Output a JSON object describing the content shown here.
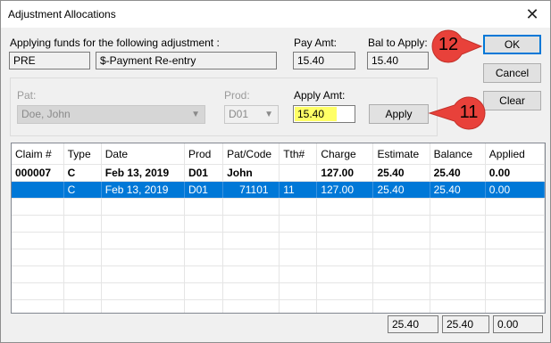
{
  "window": {
    "title": "Adjustment Allocations",
    "close_glyph": "✕"
  },
  "header": {
    "applying_label": "Applying funds for the following adjustment :",
    "code_value": "PRE",
    "desc_value": "$-Payment Re-entry",
    "pay_amt_label": "Pay Amt:",
    "pay_amt_value": "15.40",
    "bal_label": "Bal to Apply:",
    "bal_value": "15.40"
  },
  "form": {
    "pat_label": "Pat:",
    "pat_value": "Doe, John",
    "prod_label": "Prod:",
    "prod_value": "D01",
    "apply_amt_label": "Apply Amt:",
    "apply_amt_value": "15.40",
    "apply_button": "Apply"
  },
  "buttons": {
    "ok": "OK",
    "cancel": "Cancel",
    "clear": "Clear"
  },
  "markers": {
    "a": "12",
    "b": "11",
    "color": "#e8413a"
  },
  "table": {
    "columns": [
      "Claim #",
      "Type",
      "Date",
      "Prod",
      "Pat/Code",
      "Tth#",
      "Charge",
      "Estimate",
      "Balance",
      "Applied"
    ],
    "rows": [
      [
        "000007",
        "C",
        "Feb 13, 2019",
        "D01",
        "John",
        "",
        "127.00",
        "25.40",
        "25.40",
        "0.00"
      ],
      [
        "",
        "C",
        "Feb 13, 2019",
        "D01",
        "71101",
        "11",
        "127.00",
        "25.40",
        "25.40",
        "0.00"
      ]
    ]
  },
  "totals": {
    "estimate": "25.40",
    "balance": "25.40",
    "applied": "0.00"
  },
  "colors": {
    "selection": "#0078d7",
    "highlight": "#ffff66"
  }
}
